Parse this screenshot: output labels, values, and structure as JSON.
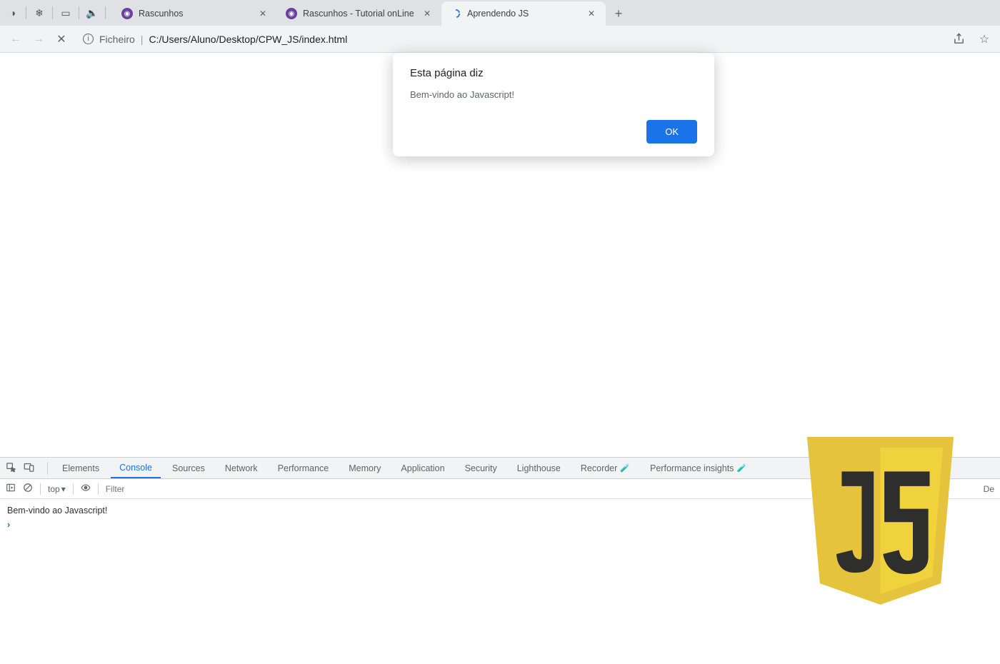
{
  "tabs": [
    {
      "title": "Rascunhos"
    },
    {
      "title": "Rascunhos - Tutorial onLine"
    },
    {
      "title": "Aprendendo JS"
    }
  ],
  "active_tab_index": 2,
  "addressbar": {
    "scheme_label": "Ficheiro",
    "path": "C:/Users/Aluno/Desktop/CPW_JS/index.html"
  },
  "dialog": {
    "title": "Esta página diz",
    "message": "Bem-vindo ao Javascript!",
    "ok_label": "OK"
  },
  "devtools": {
    "tabs": [
      "Elements",
      "Console",
      "Sources",
      "Network",
      "Performance",
      "Memory",
      "Application",
      "Security",
      "Lighthouse",
      "Recorder",
      "Performance insights"
    ],
    "active_tab_index": 1,
    "console_toolbar": {
      "context": "top",
      "filter_placeholder": "Filter",
      "right_label": "De"
    },
    "console_output": "Bem-vindo ao Javascript!"
  }
}
